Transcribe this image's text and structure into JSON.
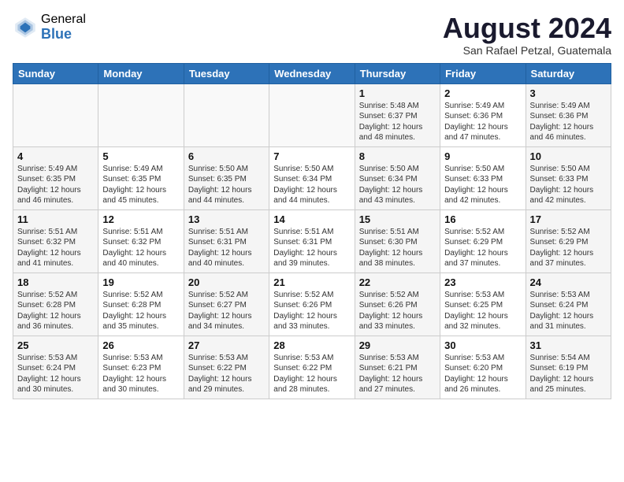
{
  "header": {
    "logo_general": "General",
    "logo_blue": "Blue",
    "month_year": "August 2024",
    "location": "San Rafael Petzal, Guatemala"
  },
  "days_of_week": [
    "Sunday",
    "Monday",
    "Tuesday",
    "Wednesday",
    "Thursday",
    "Friday",
    "Saturday"
  ],
  "weeks": [
    [
      {
        "day": "",
        "content": ""
      },
      {
        "day": "",
        "content": ""
      },
      {
        "day": "",
        "content": ""
      },
      {
        "day": "",
        "content": ""
      },
      {
        "day": "1",
        "content": "Sunrise: 5:48 AM\nSunset: 6:37 PM\nDaylight: 12 hours\nand 48 minutes."
      },
      {
        "day": "2",
        "content": "Sunrise: 5:49 AM\nSunset: 6:36 PM\nDaylight: 12 hours\nand 47 minutes."
      },
      {
        "day": "3",
        "content": "Sunrise: 5:49 AM\nSunset: 6:36 PM\nDaylight: 12 hours\nand 46 minutes."
      }
    ],
    [
      {
        "day": "4",
        "content": "Sunrise: 5:49 AM\nSunset: 6:35 PM\nDaylight: 12 hours\nand 46 minutes."
      },
      {
        "day": "5",
        "content": "Sunrise: 5:49 AM\nSunset: 6:35 PM\nDaylight: 12 hours\nand 45 minutes."
      },
      {
        "day": "6",
        "content": "Sunrise: 5:50 AM\nSunset: 6:35 PM\nDaylight: 12 hours\nand 44 minutes."
      },
      {
        "day": "7",
        "content": "Sunrise: 5:50 AM\nSunset: 6:34 PM\nDaylight: 12 hours\nand 44 minutes."
      },
      {
        "day": "8",
        "content": "Sunrise: 5:50 AM\nSunset: 6:34 PM\nDaylight: 12 hours\nand 43 minutes."
      },
      {
        "day": "9",
        "content": "Sunrise: 5:50 AM\nSunset: 6:33 PM\nDaylight: 12 hours\nand 42 minutes."
      },
      {
        "day": "10",
        "content": "Sunrise: 5:50 AM\nSunset: 6:33 PM\nDaylight: 12 hours\nand 42 minutes."
      }
    ],
    [
      {
        "day": "11",
        "content": "Sunrise: 5:51 AM\nSunset: 6:32 PM\nDaylight: 12 hours\nand 41 minutes."
      },
      {
        "day": "12",
        "content": "Sunrise: 5:51 AM\nSunset: 6:32 PM\nDaylight: 12 hours\nand 40 minutes."
      },
      {
        "day": "13",
        "content": "Sunrise: 5:51 AM\nSunset: 6:31 PM\nDaylight: 12 hours\nand 40 minutes."
      },
      {
        "day": "14",
        "content": "Sunrise: 5:51 AM\nSunset: 6:31 PM\nDaylight: 12 hours\nand 39 minutes."
      },
      {
        "day": "15",
        "content": "Sunrise: 5:51 AM\nSunset: 6:30 PM\nDaylight: 12 hours\nand 38 minutes."
      },
      {
        "day": "16",
        "content": "Sunrise: 5:52 AM\nSunset: 6:29 PM\nDaylight: 12 hours\nand 37 minutes."
      },
      {
        "day": "17",
        "content": "Sunrise: 5:52 AM\nSunset: 6:29 PM\nDaylight: 12 hours\nand 37 minutes."
      }
    ],
    [
      {
        "day": "18",
        "content": "Sunrise: 5:52 AM\nSunset: 6:28 PM\nDaylight: 12 hours\nand 36 minutes."
      },
      {
        "day": "19",
        "content": "Sunrise: 5:52 AM\nSunset: 6:28 PM\nDaylight: 12 hours\nand 35 minutes."
      },
      {
        "day": "20",
        "content": "Sunrise: 5:52 AM\nSunset: 6:27 PM\nDaylight: 12 hours\nand 34 minutes."
      },
      {
        "day": "21",
        "content": "Sunrise: 5:52 AM\nSunset: 6:26 PM\nDaylight: 12 hours\nand 33 minutes."
      },
      {
        "day": "22",
        "content": "Sunrise: 5:52 AM\nSunset: 6:26 PM\nDaylight: 12 hours\nand 33 minutes."
      },
      {
        "day": "23",
        "content": "Sunrise: 5:53 AM\nSunset: 6:25 PM\nDaylight: 12 hours\nand 32 minutes."
      },
      {
        "day": "24",
        "content": "Sunrise: 5:53 AM\nSunset: 6:24 PM\nDaylight: 12 hours\nand 31 minutes."
      }
    ],
    [
      {
        "day": "25",
        "content": "Sunrise: 5:53 AM\nSunset: 6:24 PM\nDaylight: 12 hours\nand 30 minutes."
      },
      {
        "day": "26",
        "content": "Sunrise: 5:53 AM\nSunset: 6:23 PM\nDaylight: 12 hours\nand 30 minutes."
      },
      {
        "day": "27",
        "content": "Sunrise: 5:53 AM\nSunset: 6:22 PM\nDaylight: 12 hours\nand 29 minutes."
      },
      {
        "day": "28",
        "content": "Sunrise: 5:53 AM\nSunset: 6:22 PM\nDaylight: 12 hours\nand 28 minutes."
      },
      {
        "day": "29",
        "content": "Sunrise: 5:53 AM\nSunset: 6:21 PM\nDaylight: 12 hours\nand 27 minutes."
      },
      {
        "day": "30",
        "content": "Sunrise: 5:53 AM\nSunset: 6:20 PM\nDaylight: 12 hours\nand 26 minutes."
      },
      {
        "day": "31",
        "content": "Sunrise: 5:54 AM\nSunset: 6:19 PM\nDaylight: 12 hours\nand 25 minutes."
      }
    ]
  ]
}
